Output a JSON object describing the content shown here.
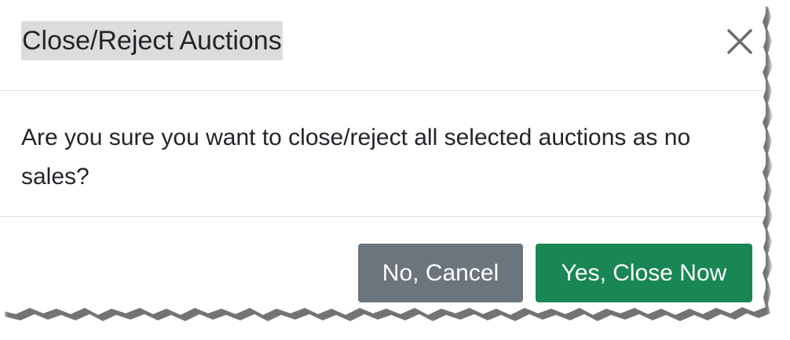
{
  "dialog": {
    "title": "Close/Reject Auctions",
    "message": "Are you sure you want to close/reject all selected auctions as no sales?",
    "close_icon": "close-icon",
    "buttons": {
      "cancel_label": "No, Cancel",
      "confirm_label": "Yes, Close Now"
    }
  },
  "colors": {
    "cancel_button": "#6c757d",
    "confirm_button": "#198754",
    "title_highlight": "#dcdcdc",
    "divider": "#dee2e6",
    "text": "#212529"
  }
}
